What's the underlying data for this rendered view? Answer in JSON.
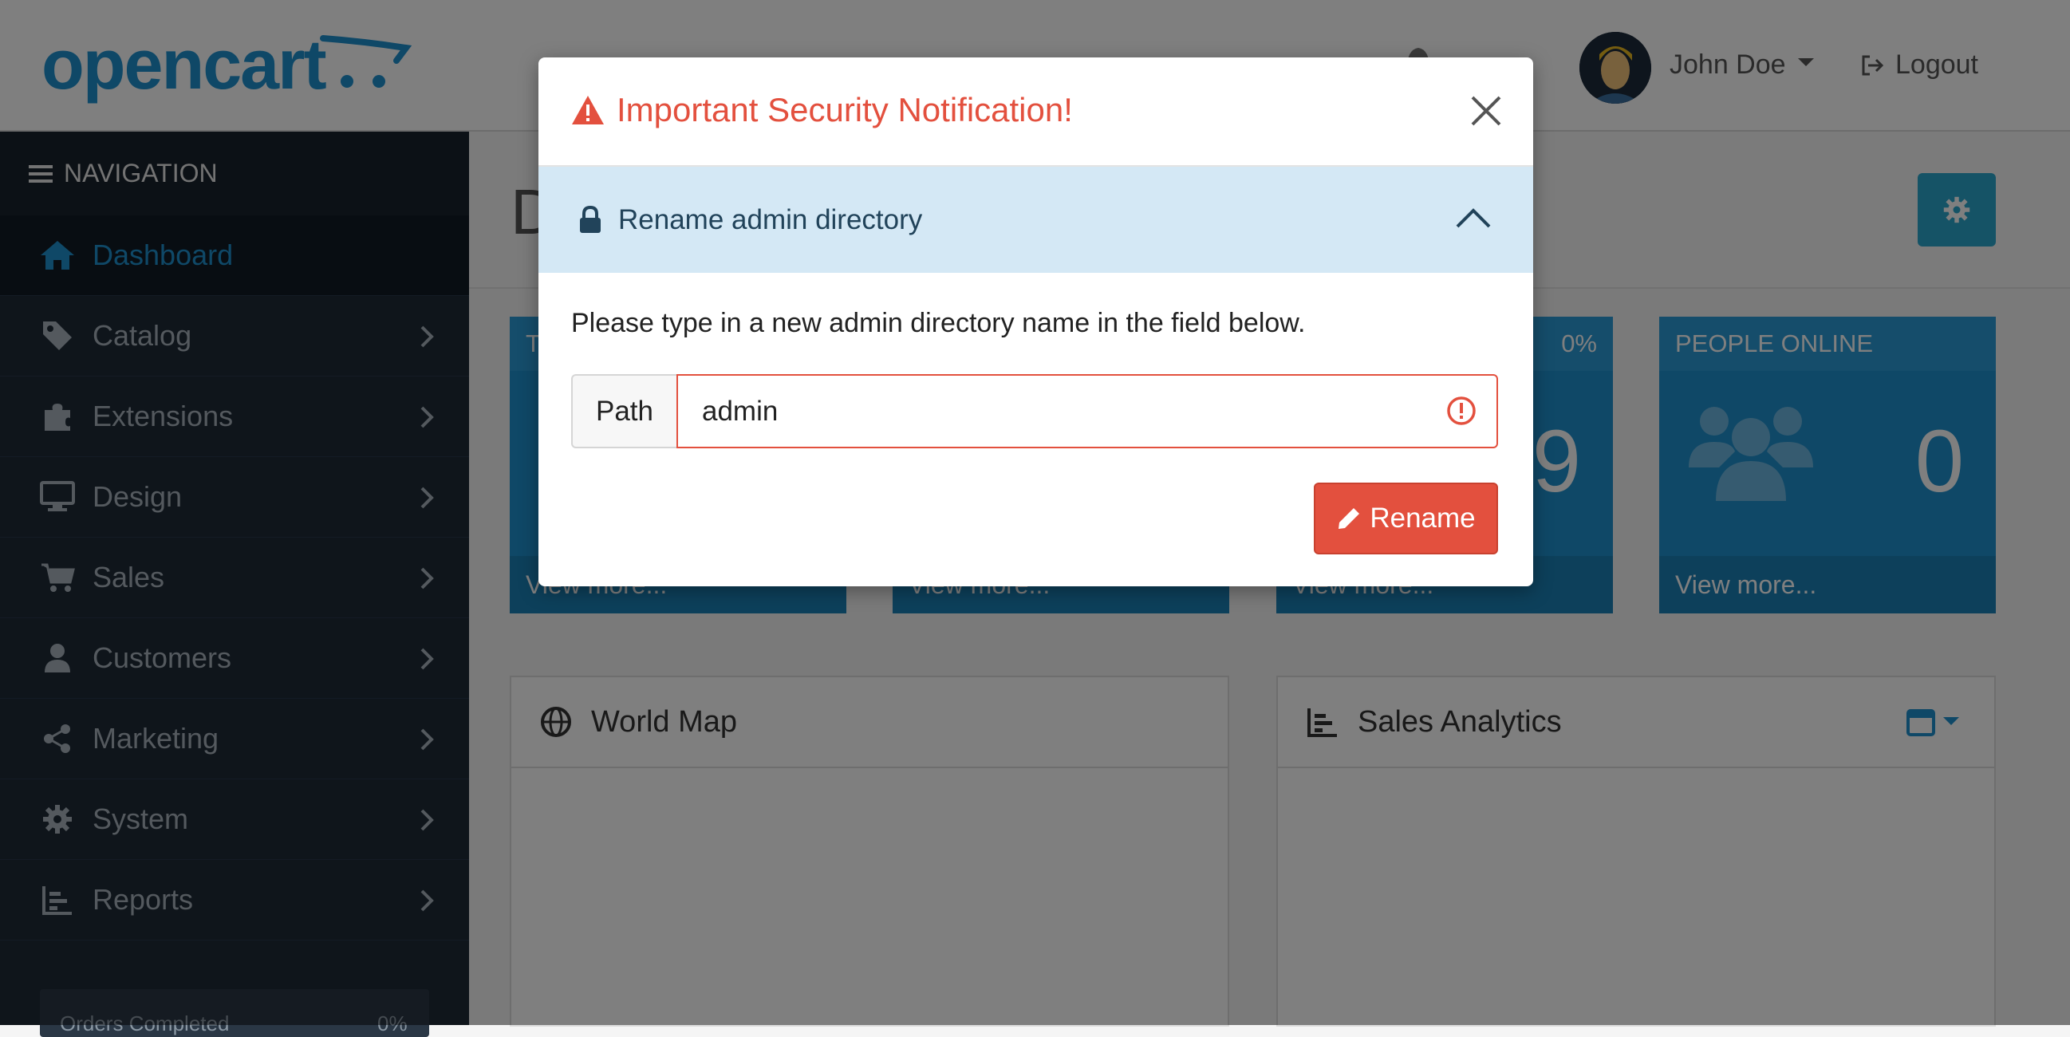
{
  "header": {
    "logo_text": "opencart",
    "user_name": "John Doe",
    "logout_label": "Logout"
  },
  "sidebar": {
    "heading": "NAVIGATION",
    "items": [
      {
        "label": "Dashboard",
        "icon": "home-icon"
      },
      {
        "label": "Catalog",
        "icon": "tag-icon"
      },
      {
        "label": "Extensions",
        "icon": "puzzle-icon"
      },
      {
        "label": "Design",
        "icon": "monitor-icon"
      },
      {
        "label": "Sales",
        "icon": "cart-icon"
      },
      {
        "label": "Customers",
        "icon": "user-icon"
      },
      {
        "label": "Marketing",
        "icon": "share-icon"
      },
      {
        "label": "System",
        "icon": "gear-icon"
      },
      {
        "label": "Reports",
        "icon": "bar-chart-icon"
      }
    ],
    "progress_label": "Orders Completed",
    "progress_value": "0%"
  },
  "main": {
    "page_title_visible": "D",
    "tiles": [
      {
        "head": "T",
        "pct": "",
        "value": "",
        "foot": "View more..."
      },
      {
        "head": "",
        "pct": "",
        "value": "",
        "foot": "View more..."
      },
      {
        "head": "",
        "pct": "0%",
        "value": "9",
        "foot": "View more..."
      },
      {
        "head": "PEOPLE ONLINE",
        "pct": "",
        "value": "0",
        "foot": "View more..."
      }
    ],
    "panels": [
      {
        "title": "World Map",
        "icon": "globe-icon"
      },
      {
        "title": "Sales Analytics",
        "icon": "bar-chart-icon"
      }
    ]
  },
  "modal": {
    "title": "Important Security Notification!",
    "accordion_title": "Rename admin directory",
    "help_text": "Please type in a new admin directory name in the field below.",
    "input_addon": "Path",
    "input_value": "admin",
    "rename_label": "Rename"
  },
  "colors": {
    "brand": "#1e91cf",
    "danger": "#e3503e",
    "sidebar": "#1e2b37",
    "accordion": "#d4e8f5"
  }
}
